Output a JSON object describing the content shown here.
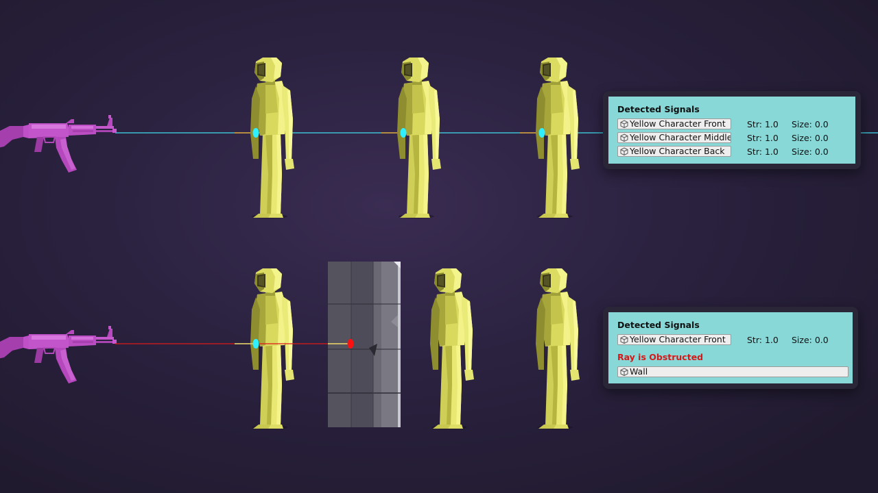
{
  "scenes": {
    "top": {
      "panel": {
        "title": "Detected Signals",
        "signals": [
          {
            "name": "Yellow Character Front",
            "str": "Str: 1.0",
            "size": "Size: 0.0"
          },
          {
            "name": "Yellow Character Middle",
            "str": "Str: 1.0",
            "size": "Size: 0.0"
          },
          {
            "name": "Yellow Character Back",
            "str": "Str: 1.0",
            "size": "Size: 0.0"
          }
        ]
      }
    },
    "bottom": {
      "panel": {
        "title": "Detected Signals",
        "signals": [
          {
            "name": "Yellow Character Front",
            "str": "Str: 1.0",
            "size": "Size: 0.0"
          }
        ],
        "obstructed_label": "Ray is Obstructed",
        "obstruction_name": "Wall"
      }
    }
  },
  "icons": {
    "weapon": "rifle-icon",
    "character": "low-poly-character-figure",
    "object": "cube-icon"
  },
  "colors": {
    "background": "#2b2240",
    "rifle": "#c050c8",
    "character": "#e8e870",
    "ray_clear": "#40e0f0",
    "ray_obstructed": "#e01818",
    "hit_point": "#30f0ff",
    "obstruction_point": "#ff1010",
    "panel_bg": "#88d8d8",
    "panel_frame": "#2a2638",
    "obstructed_text": "#d81818"
  }
}
